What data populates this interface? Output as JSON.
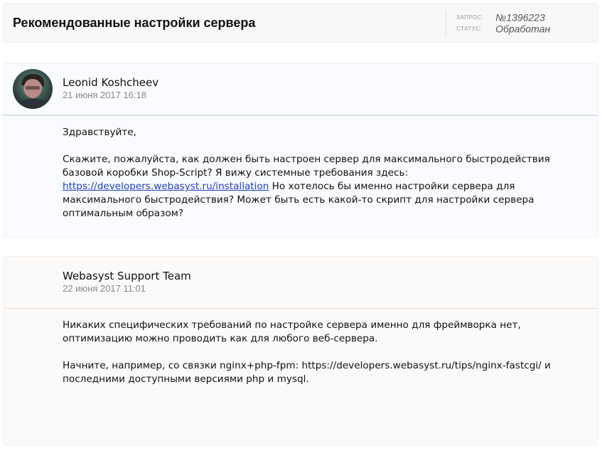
{
  "header": {
    "title": "Рекомендованные настройки сервера",
    "request_label": "ЗАПРОС:",
    "request_value": "№1396223",
    "status_label": "СТАТУС:",
    "status_value": "Обработан"
  },
  "messages": [
    {
      "author": "Leonid Koshcheev",
      "date": "21 июня 2017 16:18",
      "greeting": "Здравствуйте,",
      "text_before_link": "Скажите, пожалуйста, как должен быть настроен сервер для максимального быстродействия базовой коробки Shop-Script? Я вижу системные требования здесь: ",
      "link": "https://developers.webasyst.ru/installation",
      "text_after_link": " Но хотелось бы именно настройки сервера для максимального быстродействия? Может быть есть какой-то скрипт для настройки сервера оптимальным образом?"
    },
    {
      "author": "Webasyst Support Team",
      "date": "22 июня 2017 11:01",
      "paragraph1": "Никаких специфических требований по настройке сервера именно для фреймворка нет, оптимизацию можно проводить как для любого веб-сервера.",
      "paragraph2": "Начните, например, со связки nginx+php-fpm: https://developers.webasyst.ru/tips/nginx-fastcgi/ и последними доступными версиями php и mysql."
    }
  ]
}
